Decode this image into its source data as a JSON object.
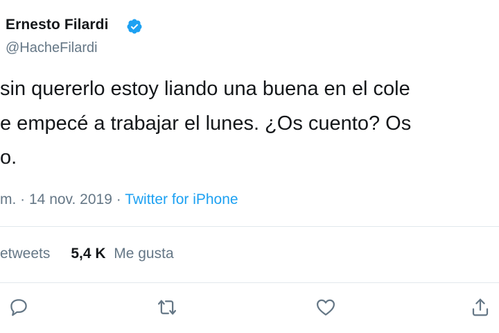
{
  "author": {
    "name": "Ernesto Filardi",
    "handle": "@HacheFilardi",
    "verified_icon": "verified-badge-icon"
  },
  "tweet": {
    "lines": [
      "sin quererlo estoy liando una buena en el cole",
      "e empecé a trabajar el lunes. ¿Os cuento? Os",
      "o."
    ]
  },
  "meta": {
    "time_fragment": "m.",
    "separator_1": " · ",
    "date": "14 nov. 2019",
    "separator_2": " · ",
    "source": "Twitter for iPhone"
  },
  "stats": {
    "retweets_label": "etweets",
    "likes_count": "5,4 K",
    "likes_label": "Me gusta"
  },
  "actions": {
    "reply_icon": "reply-icon",
    "retweet_icon": "retweet-icon",
    "like_icon": "heart-icon",
    "share_icon": "share-icon"
  },
  "colors": {
    "text": "#14171a",
    "secondary": "#657786",
    "link": "#1da1f2",
    "divider": "#e1e8ed"
  }
}
